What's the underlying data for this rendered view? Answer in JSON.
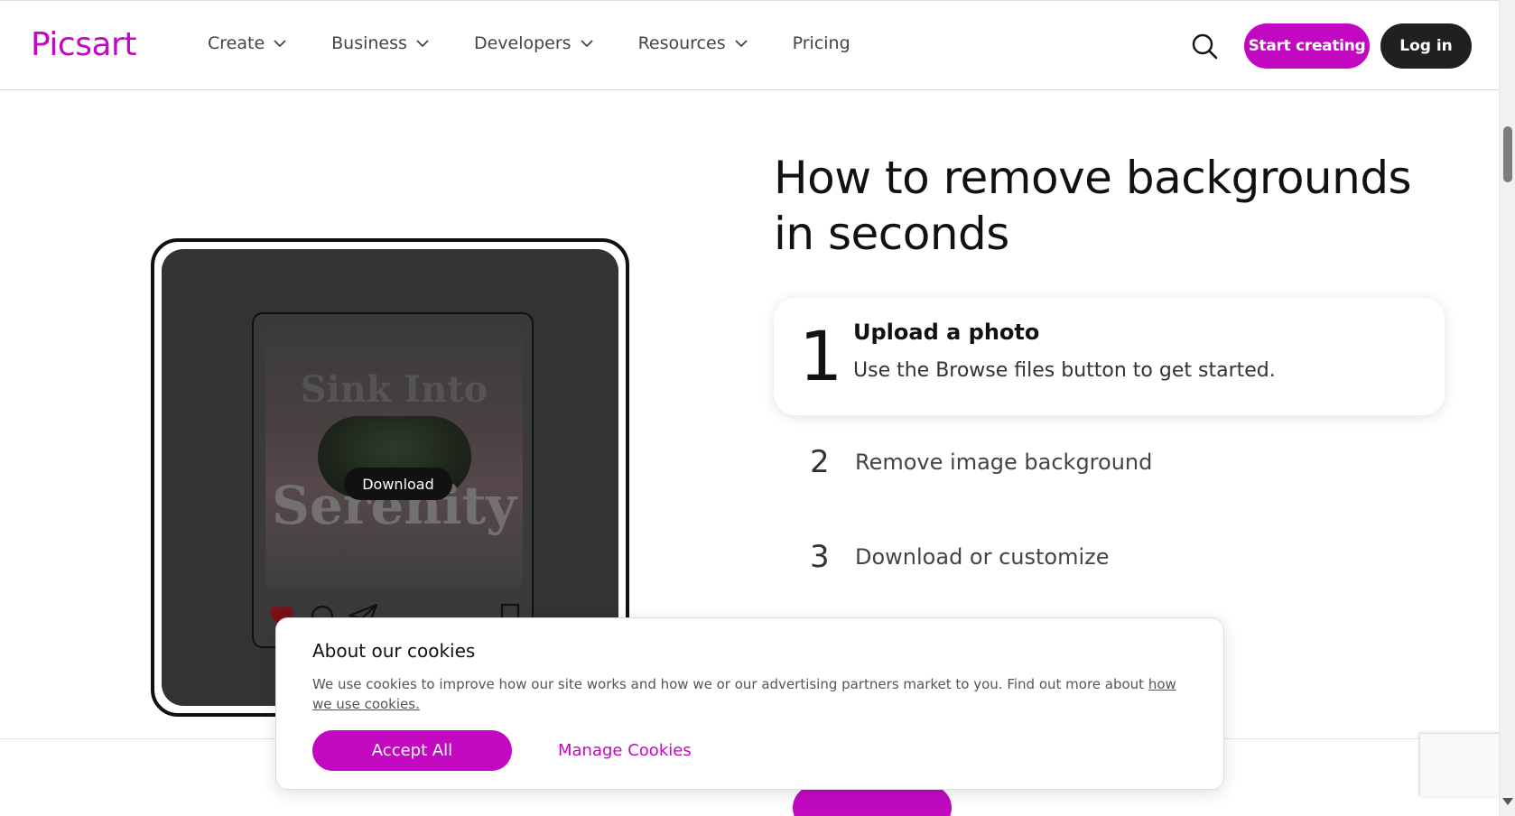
{
  "header": {
    "logo": "Picsart",
    "nav": [
      {
        "label": "Create",
        "has_menu": true
      },
      {
        "label": "Business",
        "has_menu": true
      },
      {
        "label": "Developers",
        "has_menu": true
      },
      {
        "label": "Resources",
        "has_menu": true
      },
      {
        "label": "Pricing",
        "has_menu": false
      }
    ],
    "start_label": "Start creating",
    "login_label": "Log in"
  },
  "illustration": {
    "photo_text_top": "Sink Into",
    "photo_text_bottom": "Serenity",
    "download_label": "Download"
  },
  "main": {
    "title": "How to remove backgrounds in seconds",
    "steps": [
      {
        "num": "1",
        "title": "Upload a photo",
        "desc": "Use the Browse files button to get started."
      },
      {
        "num": "2",
        "title": "Remove image background"
      },
      {
        "num": "3",
        "title": "Download or customize"
      }
    ]
  },
  "cookie": {
    "title": "About our cookies",
    "text": "We use cookies to improve how our site works and how we or our advertising partners market to you. Find out more about ",
    "link": "how we use cookies.",
    "accept_label": "Accept All",
    "manage_label": "Manage Cookies"
  },
  "colors": {
    "brand": "#c209c1",
    "dark": "#202020"
  }
}
